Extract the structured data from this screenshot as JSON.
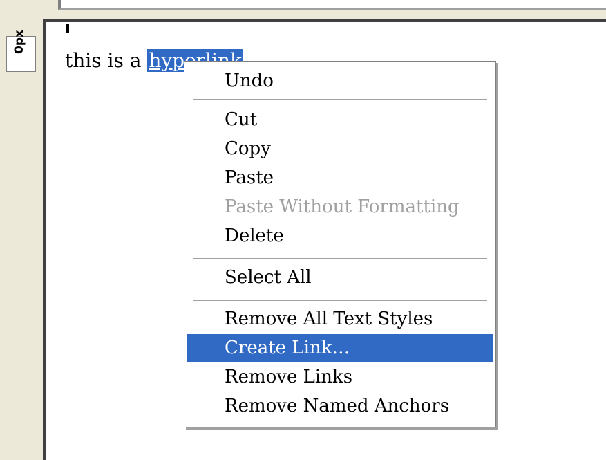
{
  "ruler": {
    "unit_label": "0px"
  },
  "editor": {
    "text_before": "this is a ",
    "selected_text": "hyperlink"
  },
  "context_menu": {
    "items": [
      {
        "label": "Undo",
        "enabled": true
      },
      {
        "label": "Cut",
        "enabled": true
      },
      {
        "label": "Copy",
        "enabled": true
      },
      {
        "label": "Paste",
        "enabled": true
      },
      {
        "label": "Paste Without Formatting",
        "enabled": false
      },
      {
        "label": "Delete",
        "enabled": true
      },
      {
        "label": "Select All",
        "enabled": true
      },
      {
        "label": "Remove All Text Styles",
        "enabled": true
      },
      {
        "label": "Create Link…",
        "enabled": true,
        "highlighted": true
      },
      {
        "label": "Remove Links",
        "enabled": true
      },
      {
        "label": "Remove Named Anchors",
        "enabled": true
      }
    ]
  },
  "colors": {
    "selection": "#316ac5",
    "disabled_text": "#a0a0a0",
    "chrome": "#ece9d8"
  }
}
